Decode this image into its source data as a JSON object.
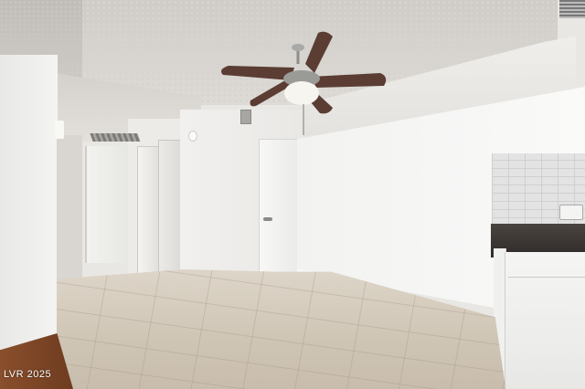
{
  "watermark": {
    "text": "LVR 2025",
    "color": "#ffffff"
  },
  "icons": [
    "ceiling-fan-icon",
    "outlet-icon",
    "door-knob-icon",
    "air-vent-icon",
    "smoke-detector-icon"
  ]
}
